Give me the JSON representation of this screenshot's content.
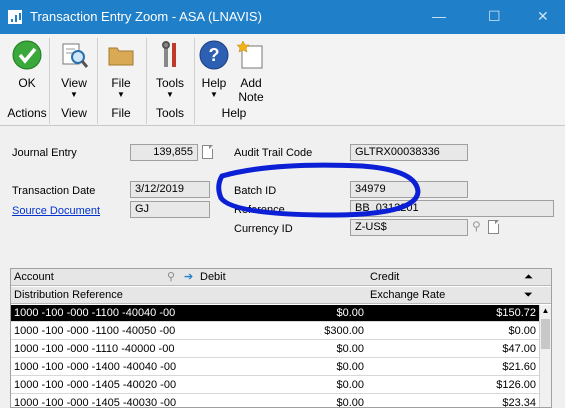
{
  "window": {
    "title": "Transaction Entry Zoom  -  ASA (LNAVIS)",
    "minimize": "—",
    "maximize": "☐",
    "close": "✕"
  },
  "ribbon": {
    "ok": "OK",
    "view": "View",
    "file": "File",
    "tools": "Tools",
    "help": "Help",
    "add_note_1": "Add",
    "add_note_2": "Note",
    "groups": {
      "actions": "Actions",
      "view": "View",
      "file": "File",
      "tools": "Tools",
      "help": "Help"
    },
    "accent": "#1f7fc8"
  },
  "form": {
    "journal_entry_label": "Journal Entry",
    "journal_entry_value": "139,855",
    "audit_trail_label": "Audit Trail Code",
    "audit_trail_value": "GLTRX00038336",
    "transaction_date_label": "Transaction Date",
    "transaction_date_value": "3/12/2019",
    "source_document_label": "Source Document",
    "source_document_value": "GJ",
    "batch_id_label": "Batch ID",
    "batch_id_value": "34979",
    "reference_label": "Reference",
    "reference_value": "BB_0312201",
    "currency_id_label": "Currency ID",
    "currency_id_value": "Z-US$"
  },
  "grid": {
    "col_account": "Account",
    "col_debit": "Debit",
    "col_credit": "Credit",
    "col_dist_ref": "Distribution Reference",
    "col_exchange_rate": "Exchange Rate",
    "rows": [
      {
        "account": "1000 -100 -000 -1100 -40040 -00",
        "debit": "$0.00",
        "credit": "$150.72"
      },
      {
        "account": "1000 -100 -000 -1100 -40050 -00",
        "debit": "$300.00",
        "credit": "$0.00"
      },
      {
        "account": "1000 -100 -000 -1110 -40000 -00",
        "debit": "$0.00",
        "credit": "$47.00"
      },
      {
        "account": "1000 -100 -000 -1400 -40040 -00",
        "debit": "$0.00",
        "credit": "$21.60"
      },
      {
        "account": "1000 -100 -000 -1405 -40020 -00",
        "debit": "$0.00",
        "credit": "$126.00"
      },
      {
        "account": "1000 -100 -000 -1405 -40030 -00",
        "debit": "$0.00",
        "credit": "$23.34"
      }
    ]
  },
  "annotation_color": "#0a1fd6"
}
